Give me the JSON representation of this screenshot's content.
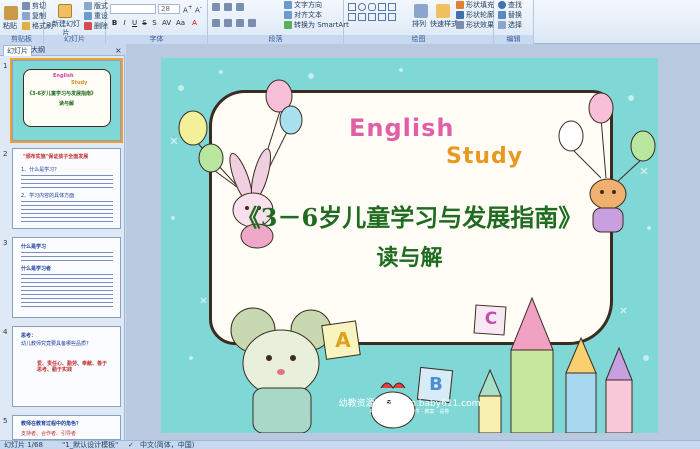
{
  "ribbon": {
    "clipboard": {
      "paste": "粘贴",
      "cut": "剪切",
      "copy": "复制",
      "format_painter": "格式刷",
      "label": "剪贴板"
    },
    "slides": {
      "new_slide": "新建幻灯片",
      "layout": "版式",
      "reset": "重设",
      "delete": "删除",
      "label": "幻灯片"
    },
    "font": {
      "font_size": "28",
      "label": "字体"
    },
    "paragraph": {
      "text_direction": "文字方向",
      "align_text": "对齐文本",
      "smartart": "转换为 SmartArt",
      "label": "段落"
    },
    "drawing": {
      "arrange": "排列",
      "quick_styles": "快速样式",
      "shape_fill": "形状填充",
      "shape_outline": "形状轮廓",
      "shape_effects": "形状效果",
      "label": "绘图"
    },
    "editing": {
      "find": "查找",
      "replace": "替换",
      "select": "选择",
      "label": "编辑"
    }
  },
  "panel": {
    "tabs": [
      "幻灯片",
      "大纲"
    ],
    "thumbs": [
      {
        "num": "1",
        "lines": [
          "English",
          "Study",
          "《3-6岁儿童学习与发展指南》",
          "读与解"
        ]
      },
      {
        "num": "2",
        "lines": [
          "\"颁布实施\"保证孩子全面发展",
          "1、什么是学习？",
          "2、学习内容的具体方面"
        ]
      },
      {
        "num": "3",
        "lines": [
          "什么是学习",
          "什么是学习者"
        ]
      },
      {
        "num": "4",
        "lines": [
          "思考：",
          "幼儿教师究竟要具备哪些品质？",
          "爱、责任心、勤劳、奉献、善于思考、勤于实践"
        ]
      },
      {
        "num": "5",
        "lines": [
          "教师在教育过程中的角色？",
          "支持者、合作者、引导者"
        ]
      }
    ]
  },
  "slide": {
    "english": "English",
    "study": "Study",
    "title": "《3－6岁儿童学习与发展指南》",
    "subtitle": "读与解",
    "letters": [
      "A",
      "B",
      "C"
    ],
    "watermark_main": "幼教资源网 ziyuan.baby611.com",
    "watermark_sub": "PPT课件 · FLASH课件 · 教案 · 试卷"
  },
  "status": {
    "slide_info": "幻灯片 1/68",
    "theme": "\"1_默认设计模板\"",
    "language": "中文(简体，中国)"
  },
  "colors": {
    "ribbon_bg": "#dbe7f6",
    "slide_bg": "#7fd7d6",
    "title_green": "#1f6b1f"
  }
}
